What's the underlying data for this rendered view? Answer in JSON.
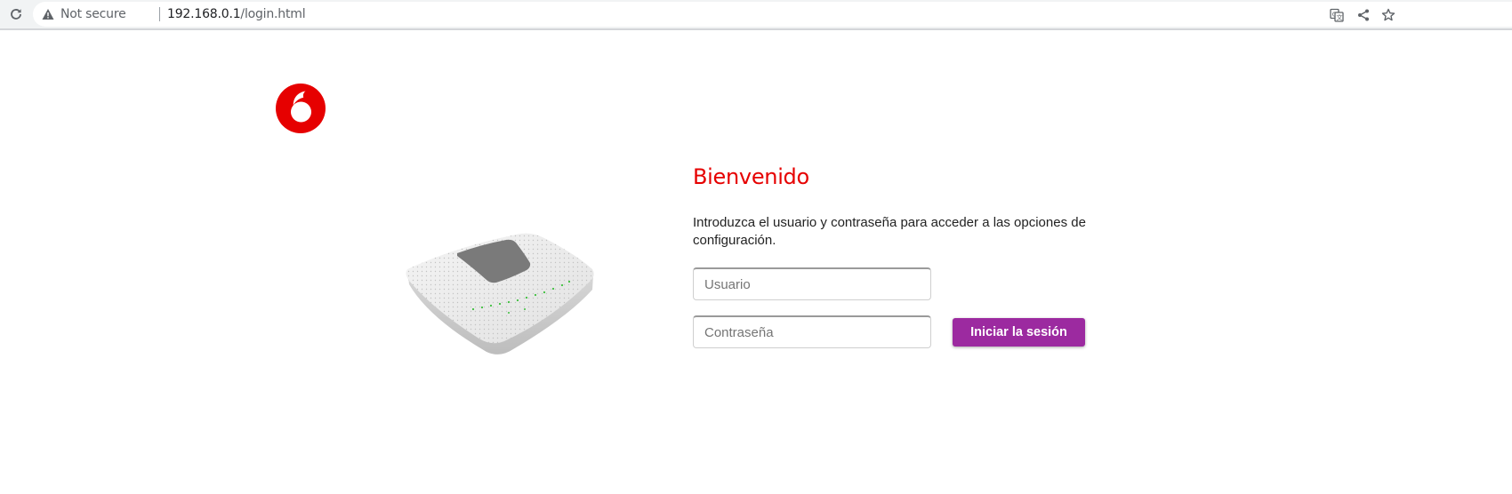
{
  "browser": {
    "security_label": "Not secure",
    "url_host": "192.168.0.1",
    "url_path": "/login.html",
    "icons": [
      "reload-icon",
      "warning-icon",
      "translate-icon",
      "share-icon",
      "bookmark-star-icon"
    ]
  },
  "brand": {
    "logo": "vodafone-logo",
    "accent_color": "#e60000",
    "button_color": "#9c2aa0"
  },
  "login": {
    "heading": "Bienvenido",
    "intro": "Introduzca el usuario y contraseña para acceder a las opciones de configuración.",
    "username_placeholder": "Usuario",
    "password_placeholder": "Contraseña",
    "submit_label": "Iniciar la sesión"
  }
}
